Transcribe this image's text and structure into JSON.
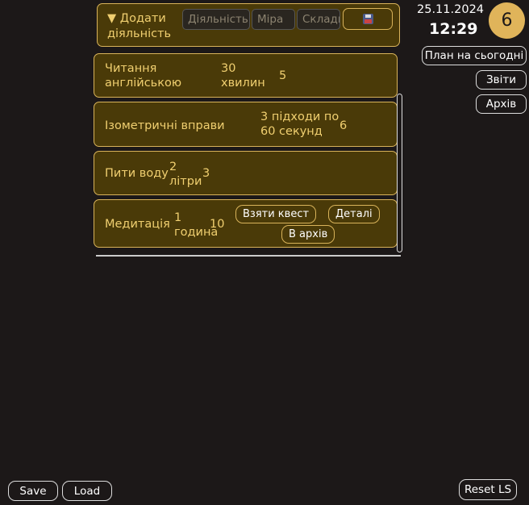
{
  "add_panel": {
    "title_line1": "▼ Додати",
    "title_line2": "діяльність",
    "activity_placeholder": "Діяльність",
    "measure_placeholder": "Міра",
    "complexity_placeholder": "Складність",
    "save_icon": "floppy-disk-icon"
  },
  "header": {
    "date": "25.11.2024",
    "time": "12:29",
    "level": "6"
  },
  "side_buttons": {
    "plan": "План на сьогодні",
    "reports": "Звіти",
    "archive": "Архів"
  },
  "tasks": [
    {
      "name_line1": "Читання",
      "name_line2": "англійською",
      "amount_line1": "30",
      "amount_line2": "хвилин",
      "difficulty": "5"
    },
    {
      "name": "Ізометричні вправи",
      "amount_line1": "3 підходи по",
      "amount_line2": "60 секунд",
      "difficulty": "6"
    },
    {
      "name": "Пити воду",
      "amount_line1": "2",
      "amount_line2": "літри",
      "difficulty": "3"
    },
    {
      "name": "Медитація",
      "amount_line1": "1",
      "amount_line2": "година",
      "difficulty": "10",
      "take_quest": "Взяти квест",
      "details": "Деталі",
      "to_archive": "В архів"
    }
  ],
  "footer": {
    "save": "Save",
    "load": "Load",
    "reset": "Reset LS"
  },
  "colors": {
    "background": "#1c1818",
    "panel": "#4a3a08",
    "accent": "#d9b35a",
    "text_gold": "#f0cf70",
    "badge": "#e0b45a"
  }
}
